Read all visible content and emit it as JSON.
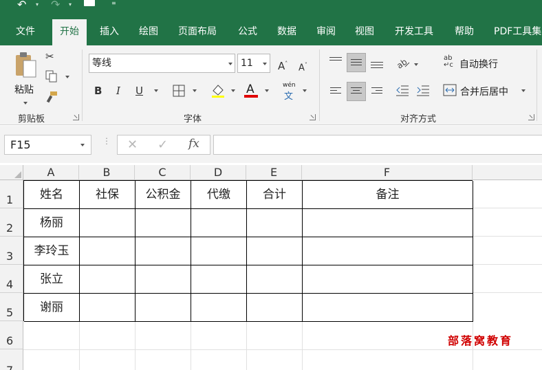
{
  "ribbon_tabs": [
    "文件",
    "开始",
    "插入",
    "绘图",
    "页面布局",
    "公式",
    "数据",
    "审阅",
    "视图",
    "开发工具",
    "帮助",
    "PDF工具集"
  ],
  "clipboard": {
    "paste_label": "粘贴",
    "group_label": "剪贴板"
  },
  "font": {
    "name": "等线",
    "size": "11",
    "bold": "B",
    "italic": "I",
    "underline": "U",
    "color_letter": "A",
    "phonetic_top": "wén",
    "phonetic_bottom": "文",
    "grow": "A",
    "shrink": "A",
    "group_label": "字体"
  },
  "alignment": {
    "wrap_text": "自动换行",
    "merge_center": "合并后居中",
    "group_label": "对齐方式"
  },
  "formula_bar": {
    "name_box": "F15",
    "fx": "fx",
    "formula": ""
  },
  "columns": [
    "A",
    "B",
    "C",
    "D",
    "E",
    "F"
  ],
  "rows": [
    "1",
    "2",
    "3",
    "4",
    "5",
    "6",
    "7"
  ],
  "table": {
    "header": [
      "姓名",
      "社保",
      "公积金",
      "代缴",
      "合计",
      "备注"
    ],
    "names": [
      "杨丽",
      "李玲玉",
      "张立",
      "谢丽"
    ]
  },
  "watermark": "部落窝教育",
  "colors": {
    "excel_green": "#217346",
    "font_color_underline": "#e00000",
    "watermark": "#d00000"
  }
}
